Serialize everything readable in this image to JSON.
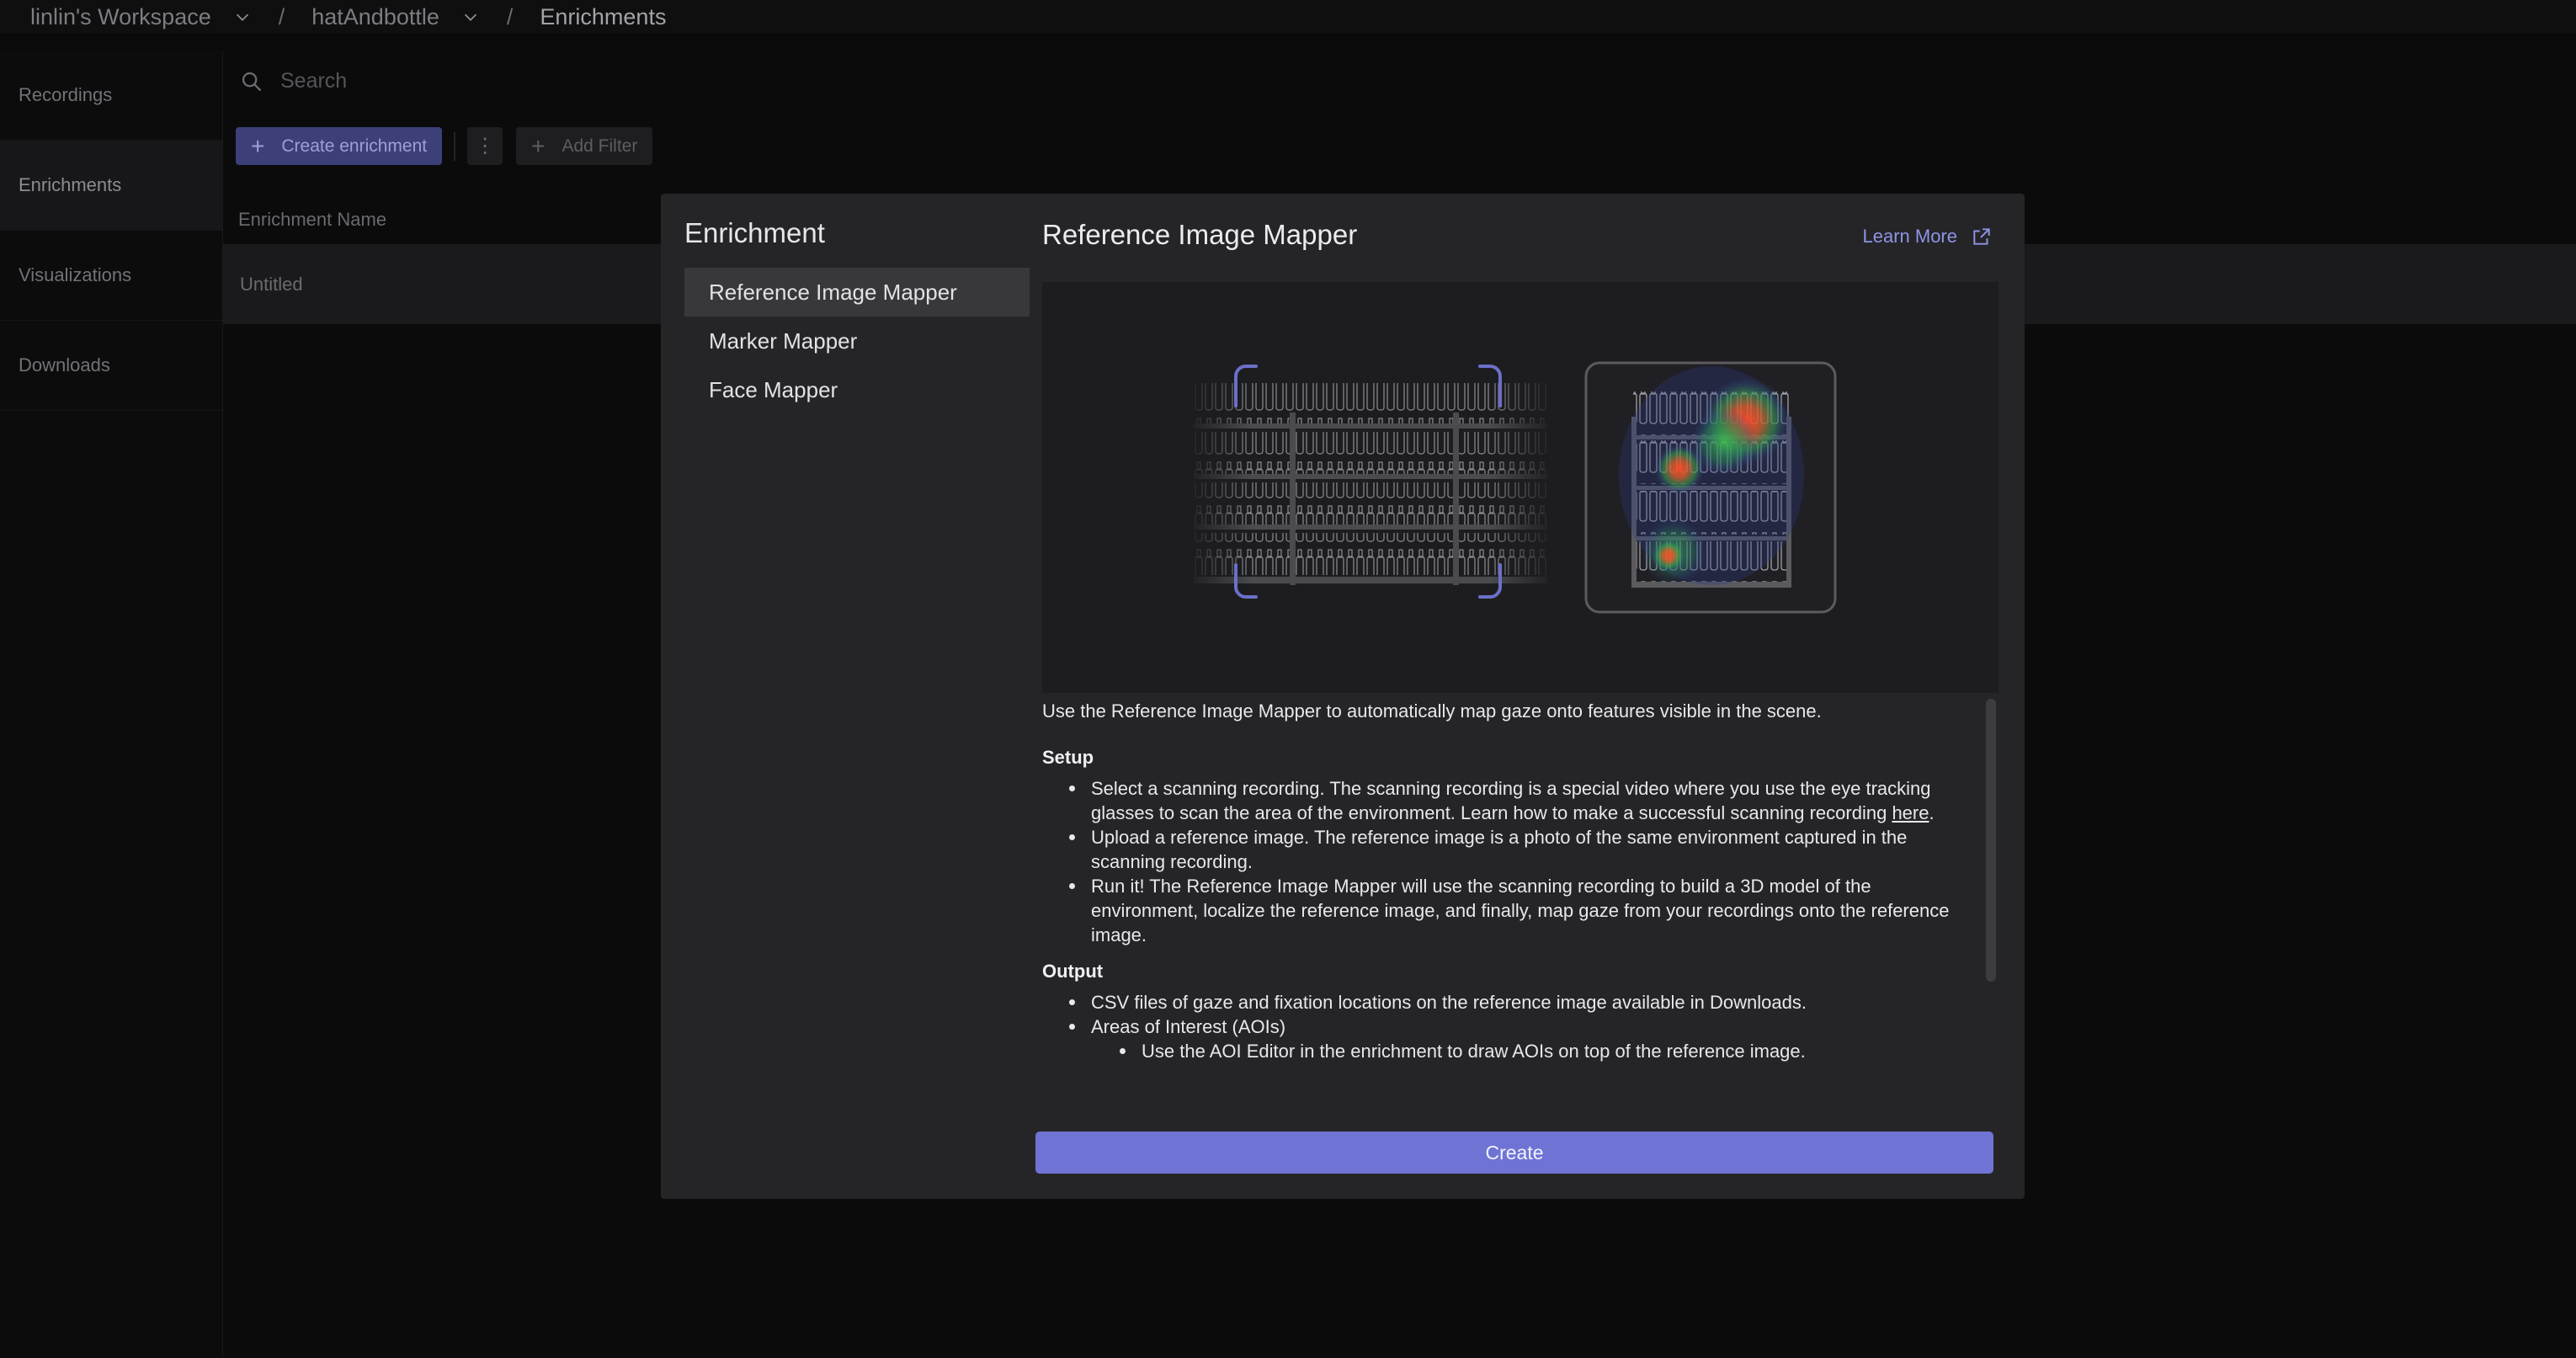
{
  "breadcrumb": {
    "workspace": "linlin's Workspace",
    "project": "hatAndbottle",
    "page": "Enrichments",
    "separator": "/"
  },
  "sidebar": {
    "items": [
      {
        "label": "Recordings"
      },
      {
        "label": "Enrichments"
      },
      {
        "label": "Visualizations"
      },
      {
        "label": "Downloads"
      }
    ]
  },
  "main": {
    "search_placeholder": "Search",
    "create_button": "Create enrichment",
    "more_button": "⋮",
    "filter_button": "Add Filter",
    "column_header": "Enrichment Name",
    "rows": [
      {
        "name": "Untitled"
      }
    ]
  },
  "modal": {
    "title": "Enrichment",
    "types": [
      {
        "label": "Reference Image Mapper"
      },
      {
        "label": "Marker Mapper"
      },
      {
        "label": "Face Mapper"
      }
    ],
    "selected_title": "Reference Image Mapper",
    "learn_more": "Learn More",
    "intro": "Use the Reference Image Mapper to automatically map gaze onto features visible in the scene.",
    "setup_heading": "Setup",
    "setup_1_text": "Select a scanning recording. The scanning recording is a special video where you use the eye tracking glasses to scan the area of the environment. Learn how to make a successful scanning recording ",
    "setup_1_link": "here",
    "setup_1_end": ".",
    "setup_2": "Upload a reference image. The reference image is a photo of the same environment captured in the scanning recording.",
    "setup_3": "Run it! The Reference Image Mapper will use the scanning recording to build a 3D model of the environment, localize the reference image, and finally, map gaze from your recordings onto the reference image.",
    "output_heading": "Output",
    "output_1": "CSV files of gaze and fixation locations on the reference image available in Downloads.",
    "output_2": "Areas of Interest (AOIs)",
    "output_2_sub": "Use the AOI Editor in the enrichment to draw AOIs on top of the reference image.",
    "create_label": "Create"
  },
  "colors": {
    "accent": "#6f74d4",
    "link": "#8f93e6",
    "bracket": "#6b70c9"
  }
}
